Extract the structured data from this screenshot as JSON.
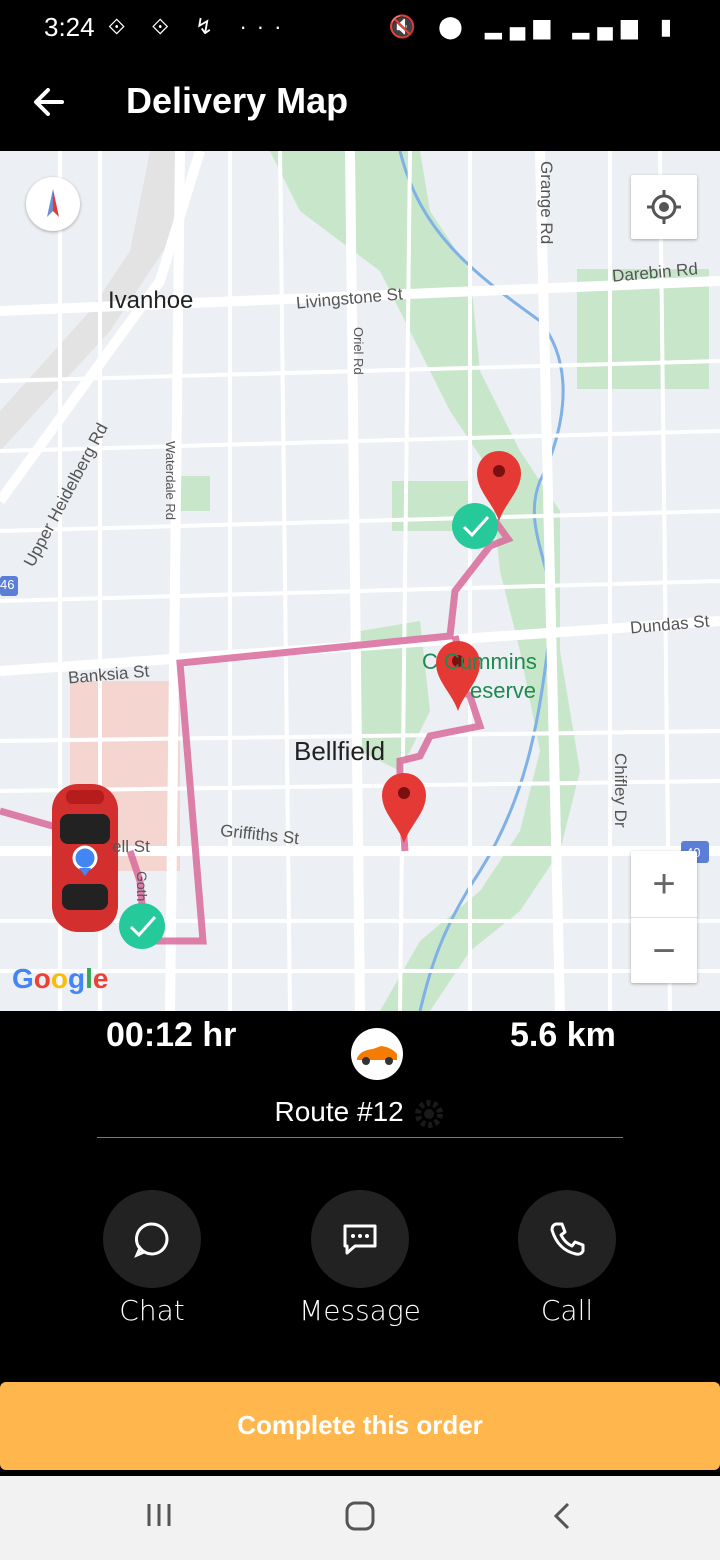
{
  "status_bar": {
    "time": "3:24",
    "left_icons": "⟐ ⟐ ↯ ···",
    "right_icons": "🔇 ⬤ ▂▄▆ ▂▄▆ ▮"
  },
  "header": {
    "title": "Delivery Map"
  },
  "map": {
    "labels": {
      "ivanhoe": "Ivanhoe",
      "livingstone": "Livingstone St",
      "oriel": "Oriel Rd",
      "grange": "Grange Rd",
      "darebin": "Darebin Rd",
      "upper_heidelberg": "Upper Heidelberg Rd",
      "waterdale": "Waterdale Rd",
      "banksia": "Banksia St",
      "dundas": "Dundas St",
      "bellfield": "Bellfield",
      "cummins1": "C   Cummins",
      "cummins2": "eserve",
      "griffiths": "Griffiths St",
      "bell": "ell St",
      "goth": "Goth",
      "chifley": "Chifley Dr",
      "route46": "46",
      "route40": "40"
    },
    "zoom_in": "+",
    "zoom_out": "−",
    "attribution": "Google"
  },
  "stats": {
    "duration": "00:12  hr",
    "distance": "5.6 km"
  },
  "route": {
    "label": "Route #12"
  },
  "actions": {
    "chat": "Chat",
    "message": "Message",
    "call": "Call"
  },
  "complete_button": "Complete this order",
  "colors": {
    "route": "#d86a9a",
    "pin": "#e53935",
    "check": "#26c99a",
    "accent": "#ffb74d"
  }
}
